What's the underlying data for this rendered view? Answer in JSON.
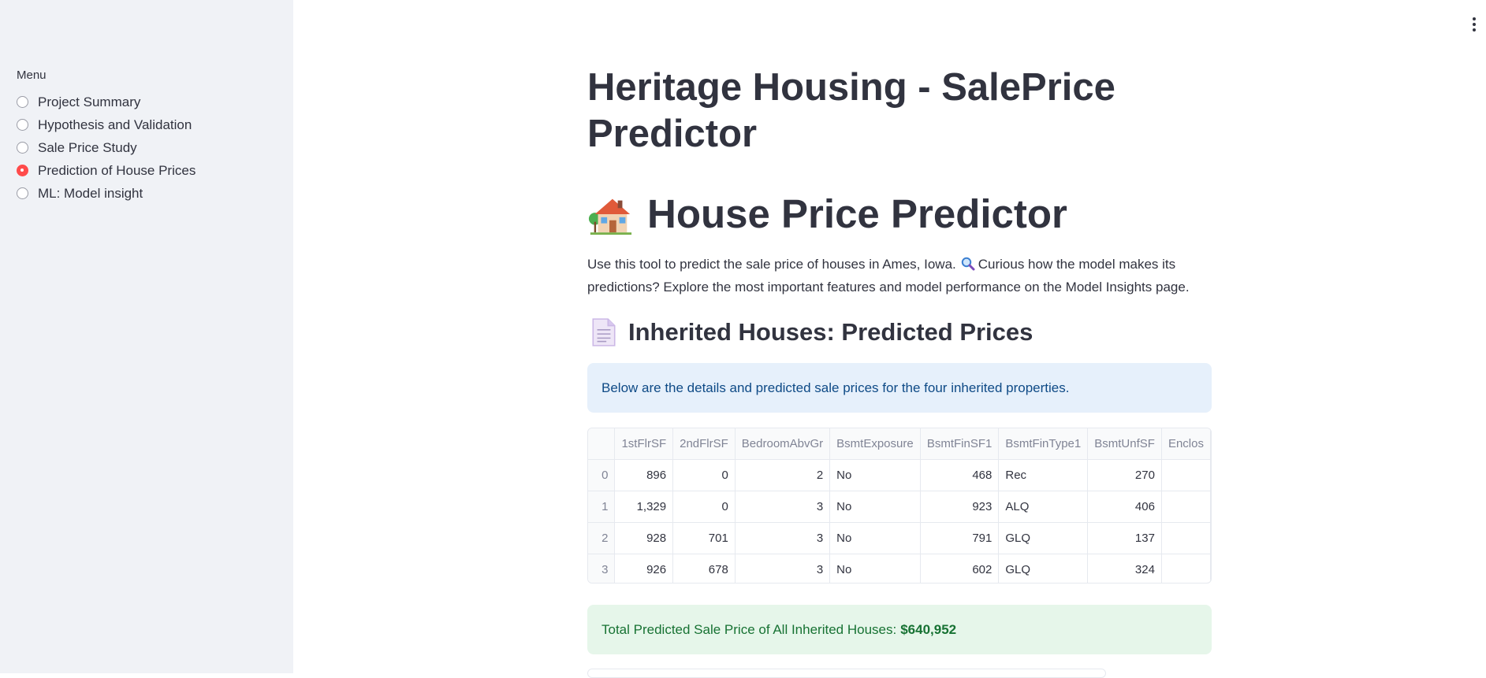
{
  "sidebar": {
    "menu_label": "Menu",
    "items": [
      {
        "label": "Project Summary",
        "selected": false
      },
      {
        "label": "Hypothesis and Validation",
        "selected": false
      },
      {
        "label": "Sale Price Study",
        "selected": false
      },
      {
        "label": "Prediction of House Prices",
        "selected": true
      },
      {
        "label": "ML: Model insight",
        "selected": false
      }
    ],
    "accent_color": "#ff4b4b"
  },
  "header": {
    "menu_icon": "kebab-menu-icon"
  },
  "main": {
    "title": "Heritage Housing - SalePrice Predictor",
    "h1": "House Price Predictor",
    "h1_icon": "house-icon",
    "intro_part1": "Use this tool to predict the sale price of houses in Ames, Iowa.",
    "intro_icon": "magnifier-icon",
    "intro_part2": "Curious how the model makes its predictions? Explore the most important features and model performance on the Model Insights page.",
    "h2": "Inherited Houses: Predicted Prices",
    "h2_icon": "document-icon",
    "info_text": "Below are the details and predicted sale prices for the four inherited properties.",
    "table": {
      "columns": [
        "",
        "1stFlrSF",
        "2ndFlrSF",
        "BedroomAbvGr",
        "BsmtExposure",
        "BsmtFinSF1",
        "BsmtFinType1",
        "BsmtUnfSF",
        "Enclos"
      ],
      "rows": [
        [
          "0",
          "896",
          "0",
          "2",
          "No",
          "468",
          "Rec",
          "270",
          ""
        ],
        [
          "1",
          "1,329",
          "0",
          "3",
          "No",
          "923",
          "ALQ",
          "406",
          ""
        ],
        [
          "2",
          "928",
          "701",
          "3",
          "No",
          "791",
          "GLQ",
          "137",
          ""
        ],
        [
          "3",
          "926",
          "678",
          "3",
          "No",
          "602",
          "GLQ",
          "324",
          ""
        ]
      ]
    },
    "total_label": "Total Predicted Sale Price of All Inherited Houses:",
    "total_value": "$640,952"
  }
}
